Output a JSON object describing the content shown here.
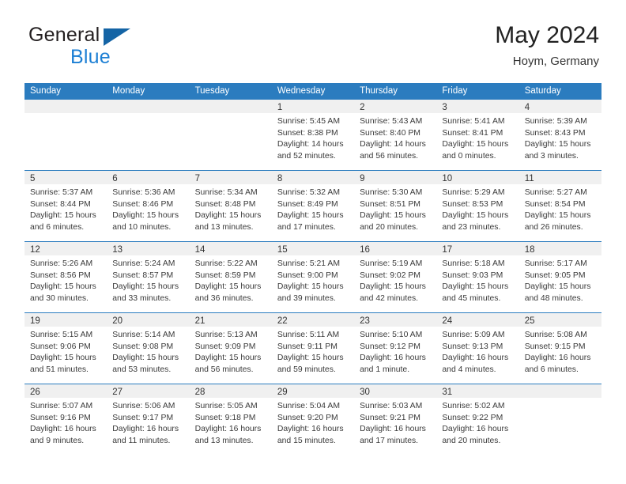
{
  "brand": {
    "name_top": "General",
    "name_bottom": "Blue",
    "triangle_color": "#1464a5",
    "blue_color": "#1c7fd4"
  },
  "header": {
    "title": "May 2024",
    "subtitle": "Hoym, Germany"
  },
  "theme": {
    "header_blue": "#2b7cbf",
    "daynum_band": "#f0f0f0",
    "cell_bg": "#ffffff",
    "text": "#3a3a3a"
  },
  "weekdays": [
    "Sunday",
    "Monday",
    "Tuesday",
    "Wednesday",
    "Thursday",
    "Friday",
    "Saturday"
  ],
  "weeks": [
    [
      {
        "day": "",
        "lines": []
      },
      {
        "day": "",
        "lines": []
      },
      {
        "day": "",
        "lines": []
      },
      {
        "day": "1",
        "lines": [
          "Sunrise: 5:45 AM",
          "Sunset: 8:38 PM",
          "Daylight: 14 hours",
          "and 52 minutes."
        ]
      },
      {
        "day": "2",
        "lines": [
          "Sunrise: 5:43 AM",
          "Sunset: 8:40 PM",
          "Daylight: 14 hours",
          "and 56 minutes."
        ]
      },
      {
        "day": "3",
        "lines": [
          "Sunrise: 5:41 AM",
          "Sunset: 8:41 PM",
          "Daylight: 15 hours",
          "and 0 minutes."
        ]
      },
      {
        "day": "4",
        "lines": [
          "Sunrise: 5:39 AM",
          "Sunset: 8:43 PM",
          "Daylight: 15 hours",
          "and 3 minutes."
        ]
      }
    ],
    [
      {
        "day": "5",
        "lines": [
          "Sunrise: 5:37 AM",
          "Sunset: 8:44 PM",
          "Daylight: 15 hours",
          "and 6 minutes."
        ]
      },
      {
        "day": "6",
        "lines": [
          "Sunrise: 5:36 AM",
          "Sunset: 8:46 PM",
          "Daylight: 15 hours",
          "and 10 minutes."
        ]
      },
      {
        "day": "7",
        "lines": [
          "Sunrise: 5:34 AM",
          "Sunset: 8:48 PM",
          "Daylight: 15 hours",
          "and 13 minutes."
        ]
      },
      {
        "day": "8",
        "lines": [
          "Sunrise: 5:32 AM",
          "Sunset: 8:49 PM",
          "Daylight: 15 hours",
          "and 17 minutes."
        ]
      },
      {
        "day": "9",
        "lines": [
          "Sunrise: 5:30 AM",
          "Sunset: 8:51 PM",
          "Daylight: 15 hours",
          "and 20 minutes."
        ]
      },
      {
        "day": "10",
        "lines": [
          "Sunrise: 5:29 AM",
          "Sunset: 8:53 PM",
          "Daylight: 15 hours",
          "and 23 minutes."
        ]
      },
      {
        "day": "11",
        "lines": [
          "Sunrise: 5:27 AM",
          "Sunset: 8:54 PM",
          "Daylight: 15 hours",
          "and 26 minutes."
        ]
      }
    ],
    [
      {
        "day": "12",
        "lines": [
          "Sunrise: 5:26 AM",
          "Sunset: 8:56 PM",
          "Daylight: 15 hours",
          "and 30 minutes."
        ]
      },
      {
        "day": "13",
        "lines": [
          "Sunrise: 5:24 AM",
          "Sunset: 8:57 PM",
          "Daylight: 15 hours",
          "and 33 minutes."
        ]
      },
      {
        "day": "14",
        "lines": [
          "Sunrise: 5:22 AM",
          "Sunset: 8:59 PM",
          "Daylight: 15 hours",
          "and 36 minutes."
        ]
      },
      {
        "day": "15",
        "lines": [
          "Sunrise: 5:21 AM",
          "Sunset: 9:00 PM",
          "Daylight: 15 hours",
          "and 39 minutes."
        ]
      },
      {
        "day": "16",
        "lines": [
          "Sunrise: 5:19 AM",
          "Sunset: 9:02 PM",
          "Daylight: 15 hours",
          "and 42 minutes."
        ]
      },
      {
        "day": "17",
        "lines": [
          "Sunrise: 5:18 AM",
          "Sunset: 9:03 PM",
          "Daylight: 15 hours",
          "and 45 minutes."
        ]
      },
      {
        "day": "18",
        "lines": [
          "Sunrise: 5:17 AM",
          "Sunset: 9:05 PM",
          "Daylight: 15 hours",
          "and 48 minutes."
        ]
      }
    ],
    [
      {
        "day": "19",
        "lines": [
          "Sunrise: 5:15 AM",
          "Sunset: 9:06 PM",
          "Daylight: 15 hours",
          "and 51 minutes."
        ]
      },
      {
        "day": "20",
        "lines": [
          "Sunrise: 5:14 AM",
          "Sunset: 9:08 PM",
          "Daylight: 15 hours",
          "and 53 minutes."
        ]
      },
      {
        "day": "21",
        "lines": [
          "Sunrise: 5:13 AM",
          "Sunset: 9:09 PM",
          "Daylight: 15 hours",
          "and 56 minutes."
        ]
      },
      {
        "day": "22",
        "lines": [
          "Sunrise: 5:11 AM",
          "Sunset: 9:11 PM",
          "Daylight: 15 hours",
          "and 59 minutes."
        ]
      },
      {
        "day": "23",
        "lines": [
          "Sunrise: 5:10 AM",
          "Sunset: 9:12 PM",
          "Daylight: 16 hours",
          "and 1 minute."
        ]
      },
      {
        "day": "24",
        "lines": [
          "Sunrise: 5:09 AM",
          "Sunset: 9:13 PM",
          "Daylight: 16 hours",
          "and 4 minutes."
        ]
      },
      {
        "day": "25",
        "lines": [
          "Sunrise: 5:08 AM",
          "Sunset: 9:15 PM",
          "Daylight: 16 hours",
          "and 6 minutes."
        ]
      }
    ],
    [
      {
        "day": "26",
        "lines": [
          "Sunrise: 5:07 AM",
          "Sunset: 9:16 PM",
          "Daylight: 16 hours",
          "and 9 minutes."
        ]
      },
      {
        "day": "27",
        "lines": [
          "Sunrise: 5:06 AM",
          "Sunset: 9:17 PM",
          "Daylight: 16 hours",
          "and 11 minutes."
        ]
      },
      {
        "day": "28",
        "lines": [
          "Sunrise: 5:05 AM",
          "Sunset: 9:18 PM",
          "Daylight: 16 hours",
          "and 13 minutes."
        ]
      },
      {
        "day": "29",
        "lines": [
          "Sunrise: 5:04 AM",
          "Sunset: 9:20 PM",
          "Daylight: 16 hours",
          "and 15 minutes."
        ]
      },
      {
        "day": "30",
        "lines": [
          "Sunrise: 5:03 AM",
          "Sunset: 9:21 PM",
          "Daylight: 16 hours",
          "and 17 minutes."
        ]
      },
      {
        "day": "31",
        "lines": [
          "Sunrise: 5:02 AM",
          "Sunset: 9:22 PM",
          "Daylight: 16 hours",
          "and 20 minutes."
        ]
      },
      {
        "day": "",
        "lines": []
      }
    ]
  ]
}
